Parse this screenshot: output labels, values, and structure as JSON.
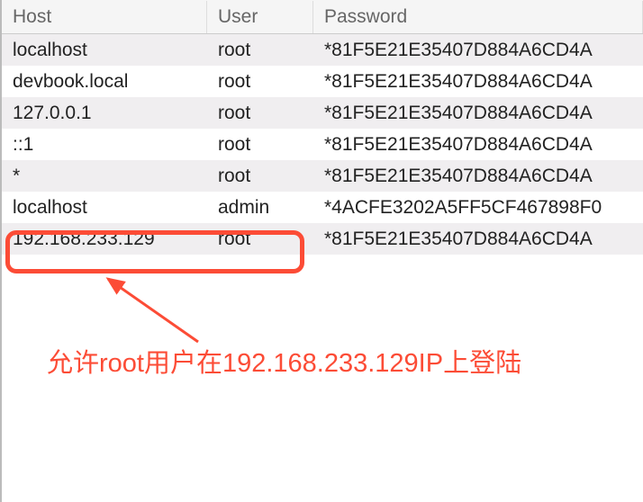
{
  "table": {
    "columns": {
      "host": "Host",
      "user": "User",
      "password": "Password"
    },
    "rows": [
      {
        "host": "localhost",
        "user": "root",
        "password": "*81F5E21E35407D884A6CD4A"
      },
      {
        "host": "devbook.local",
        "user": "root",
        "password": "*81F5E21E35407D884A6CD4A"
      },
      {
        "host": "127.0.0.1",
        "user": "root",
        "password": "*81F5E21E35407D884A6CD4A"
      },
      {
        "host": "::1",
        "user": "root",
        "password": "*81F5E21E35407D884A6CD4A"
      },
      {
        "host": "*",
        "user": "root",
        "password": "*81F5E21E35407D884A6CD4A"
      },
      {
        "host": "localhost",
        "user": "admin",
        "password": "*4ACFE3202A5FF5CF467898F0"
      },
      {
        "host": "192.168.233.129",
        "user": "root",
        "password": "*81F5E21E35407D884A6CD4A"
      }
    ]
  },
  "annotation": {
    "text": "允许root用户在192.168.233.129IP上登陆",
    "highlight_color": "#fc4c36"
  }
}
